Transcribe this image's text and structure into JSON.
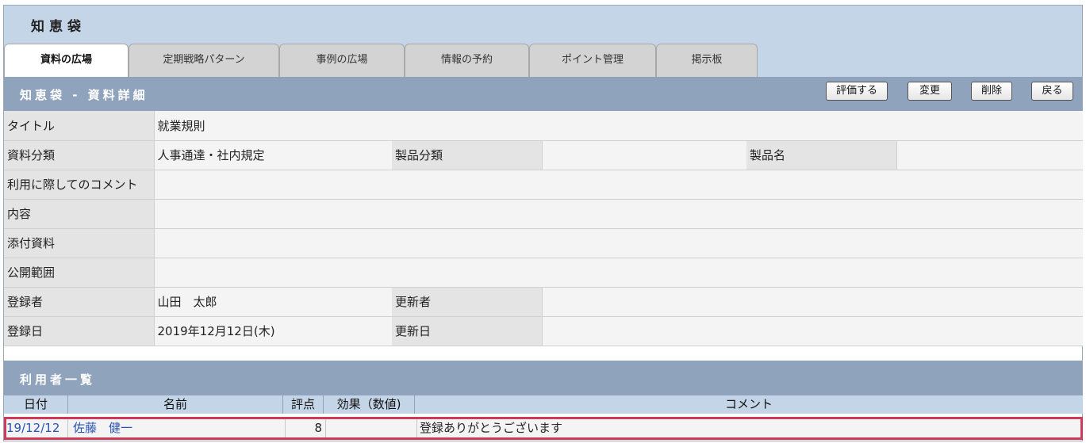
{
  "app": {
    "title": "知恵袋"
  },
  "tabs": [
    {
      "label": "資料の広場",
      "active": true
    },
    {
      "label": "定期戦略パターン",
      "active": false
    },
    {
      "label": "事例の広場",
      "active": false
    },
    {
      "label": "情報の予約",
      "active": false
    },
    {
      "label": "ポイント管理",
      "active": false
    },
    {
      "label": "掲示板",
      "active": false
    }
  ],
  "detail": {
    "title": "知恵袋 - 資料詳細",
    "buttons": {
      "rate": "評価する",
      "edit": "変更",
      "delete": "削除",
      "back": "戻る"
    },
    "fields": {
      "title_label": "タイトル",
      "title_value": "就業規則",
      "category_label": "資料分類",
      "category_value": "人事通達・社内規定",
      "product_category_label": "製品分類",
      "product_category_value": "",
      "product_name_label": "製品名",
      "product_name_value": "",
      "usage_comment_label": "利用に際してのコメント",
      "usage_comment_value": "",
      "content_label": "内容",
      "content_value": "",
      "attachment_label": "添付資料",
      "attachment_value": "",
      "scope_label": "公開範囲",
      "scope_value": "",
      "registrant_label": "登録者",
      "registrant_value": "山田　太郎",
      "updater_label": "更新者",
      "updater_value": "",
      "registered_date_label": "登録日",
      "registered_date_value": "2019年12月12日(木)",
      "updated_date_label": "更新日",
      "updated_date_value": ""
    }
  },
  "users": {
    "title": "利用者一覧",
    "columns": {
      "date": "日付",
      "name": "名前",
      "score": "評点",
      "effect": "効果（数値)",
      "comment": "コメント"
    },
    "rows": [
      {
        "date": "19/12/12",
        "name": "佐藤　健一",
        "score": "8",
        "effect": "",
        "comment": "登録ありがとうございます"
      }
    ]
  },
  "colors": {
    "header_bg": "#c5d5e8",
    "section_bg": "#8fa3bc",
    "link": "#2952b3",
    "highlight": "#d23a5a"
  }
}
